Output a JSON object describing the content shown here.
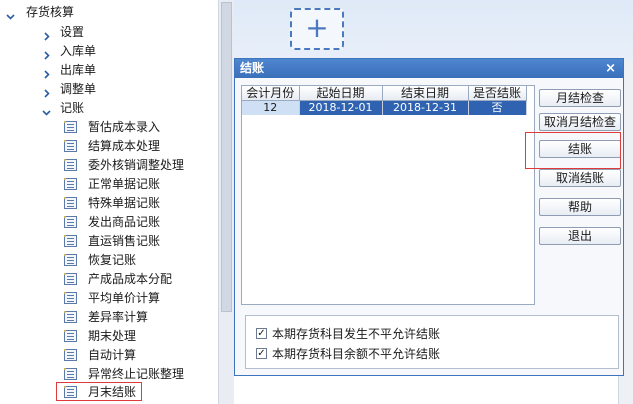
{
  "tree": {
    "root": "存货核算",
    "groups": [
      "设置",
      "入库单",
      "出库单",
      "调整单"
    ],
    "open_group": "记账",
    "items": [
      "暂估成本录入",
      "结算成本处理",
      "委外核销调整处理",
      "正常单据记账",
      "特殊单据记账",
      "发出商品记账",
      "直运销售记账",
      "恢复记账",
      "产成品成本分配",
      "平均单价计算",
      "差异率计算",
      "期末处理",
      "自动计算",
      "异常终止记账整理",
      "月末结账"
    ]
  },
  "workspace": {
    "add_label": "+"
  },
  "dialog": {
    "title": "结账",
    "close": "×",
    "table": {
      "headers": [
        "会计月份",
        "起始日期",
        "结束日期",
        "是否结账"
      ],
      "rows": [
        [
          "12",
          "2018-12-01",
          "2018-12-31",
          "否"
        ]
      ]
    },
    "buttons": [
      "月结检查",
      "取消月结检查",
      "结账",
      "取消结账",
      "帮助",
      "退出"
    ],
    "options": [
      "本期存货科目发生不平允许结账",
      "本期存货科目余额不平允许结账"
    ]
  },
  "colors": {
    "title_blue": "#3a6fba",
    "selection": "#2f63b1",
    "highlight_red": "#e23a3a"
  },
  "icons": {
    "expanded": "caret-down-icon",
    "collapsed": "caret-right-icon",
    "leaf": "document-list-icon",
    "checked": "check-icon"
  }
}
